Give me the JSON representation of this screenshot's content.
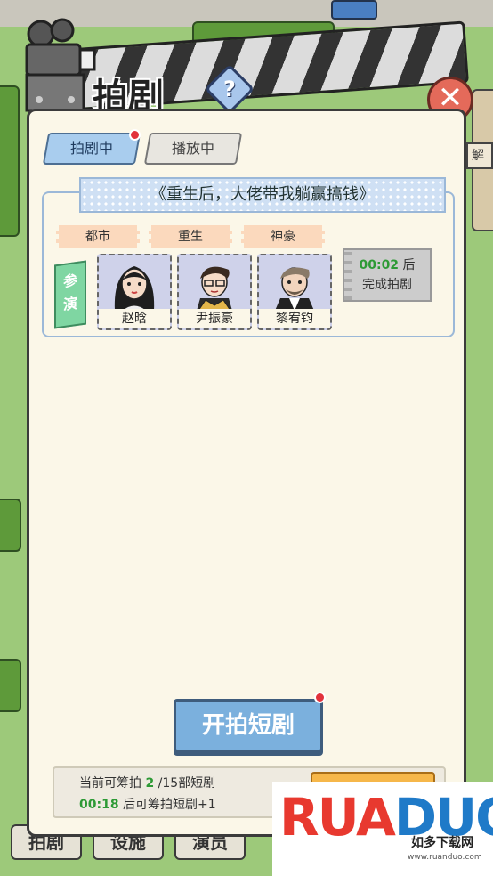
{
  "header": {
    "title": "拍剧",
    "help_label": "?",
    "close_label": "✕"
  },
  "tabs": [
    {
      "label": "拍剧中",
      "active": true,
      "has_dot": true
    },
    {
      "label": "播放中",
      "active": false,
      "has_dot": false
    }
  ],
  "drama": {
    "name": "《重生后，大佬带我躺赢搞钱》",
    "genres": [
      "都市",
      "重生",
      "神豪"
    ],
    "cast_label": "参演",
    "actors": [
      {
        "name": "赵晗",
        "portrait": "woman-portrait"
      },
      {
        "name": "尹振豪",
        "portrait": "man-glasses-portrait"
      },
      {
        "name": "黎宥钧",
        "portrait": "man-beard-portrait"
      }
    ],
    "timer": {
      "time": "00:02",
      "suffix": "后",
      "status": "完成拍剧"
    }
  },
  "start_button": {
    "label": "开拍短剧",
    "has_dot": true
  },
  "quota": {
    "prefix": "当前可筹拍",
    "count": "2",
    "suffix": "/15部短剧",
    "time": "00:18",
    "time_suffix": "后可筹拍短剧+1"
  },
  "bottom_nav": [
    "拍剧",
    "设施",
    "演员"
  ],
  "side_text": "解",
  "watermark": {
    "brand": "RUANDUO",
    "cn": "如多下载网",
    "url": "www.ruanduo.com"
  },
  "colors": {
    "accent_blue": "#7bb0dd",
    "green_time": "#2d9a35",
    "red_dot": "#e2323c"
  }
}
